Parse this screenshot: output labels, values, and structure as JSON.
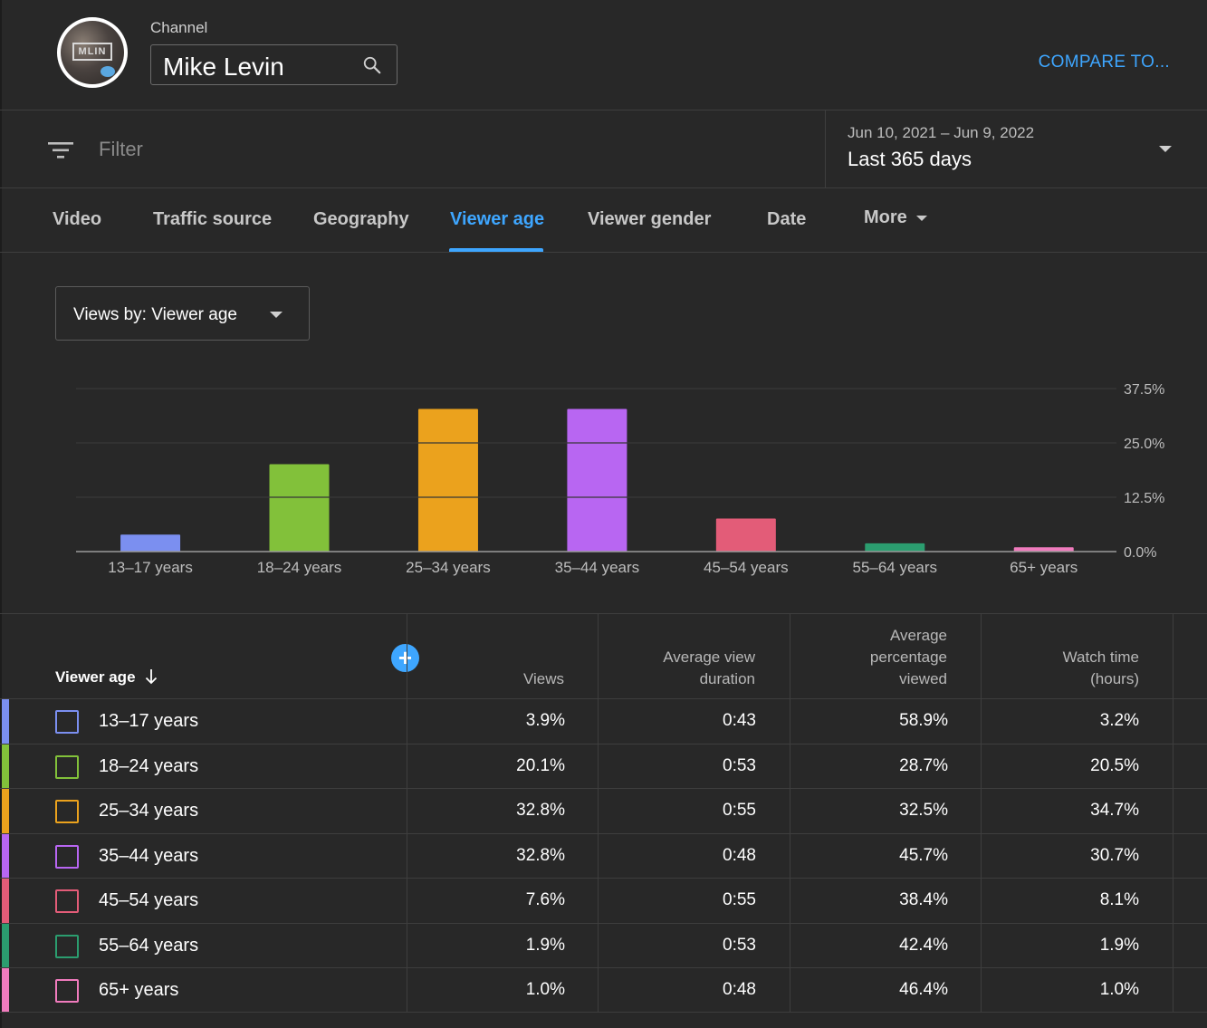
{
  "header": {
    "channel_label": "Channel",
    "channel_name": "Mike Levin",
    "avatar_text": "MLIN",
    "compare_label": "COMPARE TO..."
  },
  "filter": {
    "placeholder": "Filter",
    "date_range": "Jun 10, 2021 – Jun 9, 2022",
    "period": "Last 365 days"
  },
  "tabs": [
    {
      "label": "Video",
      "active": false
    },
    {
      "label": "Traffic source",
      "active": false
    },
    {
      "label": "Geography",
      "active": false
    },
    {
      "label": "Viewer age",
      "active": true
    },
    {
      "label": "Viewer gender",
      "active": false
    },
    {
      "label": "Date",
      "active": false
    },
    {
      "label": "More",
      "active": false
    }
  ],
  "views_select": {
    "label": "Views by: Viewer age"
  },
  "colors": {
    "accent": "#3ea6ff",
    "series": [
      "#7b8ff0",
      "#82c13a",
      "#eba21d",
      "#b866f2",
      "#e35c78",
      "#2b9d6f",
      "#f07bbd"
    ]
  },
  "chart_data": {
    "type": "bar",
    "categories": [
      "13–17 years",
      "18–24 years",
      "25–34 years",
      "35–44 years",
      "45–54 years",
      "55–64 years",
      "65+ years"
    ],
    "values": [
      3.9,
      20.1,
      32.8,
      32.8,
      7.6,
      1.9,
      1.0
    ],
    "yticks": [
      "0.0%",
      "12.5%",
      "25.0%",
      "37.5%"
    ],
    "ylim": [
      0,
      37.5
    ],
    "grid": true,
    "ylabel_position": "right"
  },
  "table": {
    "columns": [
      "Viewer age",
      "Views",
      "Average view duration",
      "Average percentage viewed",
      "Watch time (hours)"
    ],
    "column_lines": [
      [
        "Viewer age"
      ],
      [
        "Views"
      ],
      [
        "Average view",
        "duration"
      ],
      [
        "Average",
        "percentage",
        "viewed"
      ],
      [
        "Watch time",
        "(hours)"
      ]
    ],
    "rows": [
      {
        "age": "13–17 years",
        "views": "3.9%",
        "avg_duration": "0:43",
        "avg_pct": "58.9%",
        "watch_time": "3.2%"
      },
      {
        "age": "18–24 years",
        "views": "20.1%",
        "avg_duration": "0:53",
        "avg_pct": "28.7%",
        "watch_time": "20.5%"
      },
      {
        "age": "25–34 years",
        "views": "32.8%",
        "avg_duration": "0:55",
        "avg_pct": "32.5%",
        "watch_time": "34.7%"
      },
      {
        "age": "35–44 years",
        "views": "32.8%",
        "avg_duration": "0:48",
        "avg_pct": "45.7%",
        "watch_time": "30.7%"
      },
      {
        "age": "45–54 years",
        "views": "7.6%",
        "avg_duration": "0:55",
        "avg_pct": "38.4%",
        "watch_time": "8.1%"
      },
      {
        "age": "55–64 years",
        "views": "1.9%",
        "avg_duration": "0:53",
        "avg_pct": "42.4%",
        "watch_time": "1.9%"
      },
      {
        "age": "65+ years",
        "views": "1.0%",
        "avg_duration": "0:48",
        "avg_pct": "46.4%",
        "watch_time": "1.0%"
      }
    ]
  }
}
